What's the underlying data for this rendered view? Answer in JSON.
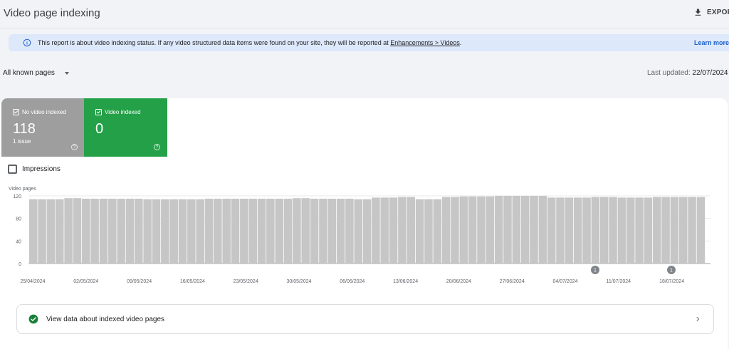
{
  "header": {
    "title": "Video page indexing",
    "export_label": "EXPORT"
  },
  "banner": {
    "text": "This report is about video indexing status. If any video structured data items were found on your site, they will be reported at ",
    "link_text": "Enhancements > Videos",
    "text_end": ".",
    "learn_more": "Learn more"
  },
  "filter": {
    "label": "All known pages"
  },
  "last_updated": {
    "label": "Last updated:",
    "value": "22/07/2024"
  },
  "tiles": {
    "no_video": {
      "label": "No video indexed",
      "value": "118",
      "sub": "1 issue"
    },
    "indexed": {
      "label": "Video indexed",
      "value": "0"
    }
  },
  "impressions": {
    "label": "Impressions"
  },
  "colors": {
    "gray_tile": "#9e9e9e",
    "green_tile": "#24a148",
    "bar": "#c6c6c6",
    "accent": "#1a5fc9"
  },
  "chart_data": {
    "type": "bar",
    "ylabel": "Video pages",
    "ylim": [
      0,
      120
    ],
    "yticks": [
      0,
      40,
      80,
      120
    ],
    "x_tick_labels": [
      "25/04/2024",
      "02/05/2024",
      "09/05/2024",
      "16/05/2024",
      "23/05/2024",
      "30/05/2024",
      "06/06/2024",
      "13/06/2024",
      "20/06/2024",
      "27/06/2024",
      "04/07/2024",
      "11/07/2024",
      "18/07/2024"
    ],
    "values": [
      114,
      114,
      114,
      114,
      116,
      116,
      115,
      115,
      115,
      115,
      115,
      115,
      115,
      114,
      114,
      114,
      114,
      114,
      114,
      114,
      115,
      115,
      115,
      115,
      115,
      115,
      115,
      115,
      115,
      115,
      116,
      116,
      115,
      115,
      115,
      115,
      115,
      114,
      114,
      117,
      117,
      117,
      118,
      118,
      114,
      114,
      114,
      118,
      118,
      119,
      119,
      119,
      119,
      120,
      120,
      120,
      120,
      120,
      120,
      117,
      117,
      117,
      117,
      117,
      118,
      118,
      118,
      117,
      117,
      117,
      117,
      118,
      118,
      118,
      118,
      118,
      118
    ],
    "annotations": [
      {
        "date": "08/07/2024",
        "label": "1"
      },
      {
        "date": "17/07/2024",
        "label": "1"
      }
    ]
  },
  "view_data": {
    "label": "View data about indexed video pages"
  }
}
